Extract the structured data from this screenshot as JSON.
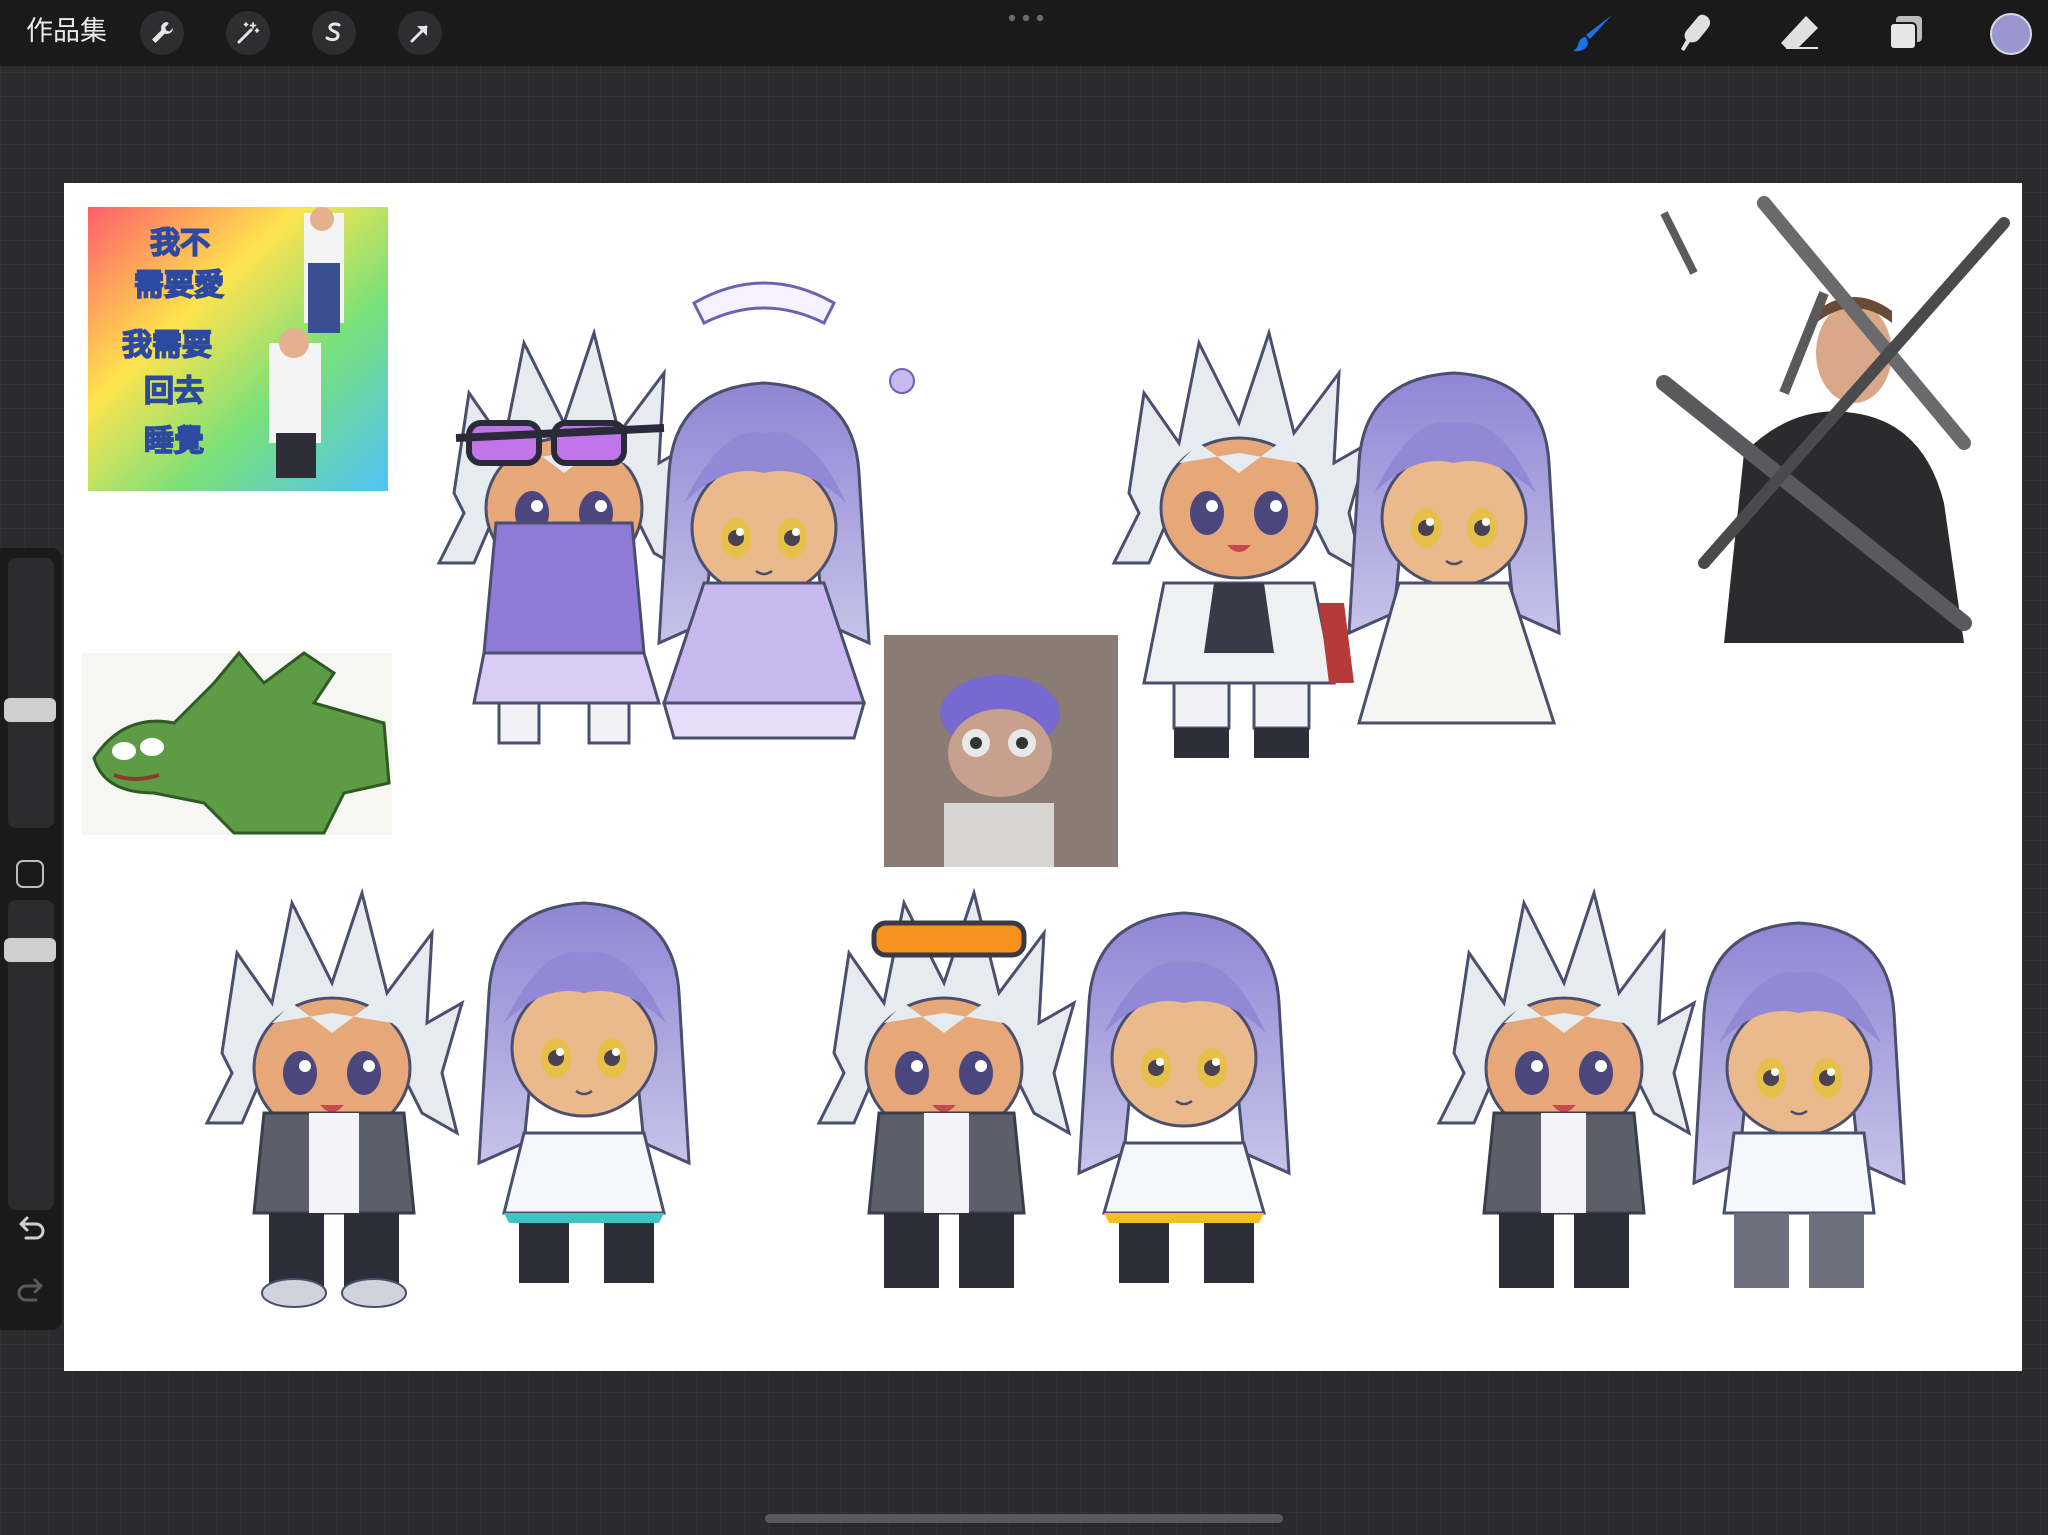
{
  "topbar": {
    "gallery_label": "作品集",
    "left_tools": [
      {
        "name": "actions",
        "icon": "wrench-icon"
      },
      {
        "name": "adjustments",
        "icon": "magic-wand-icon"
      },
      {
        "name": "selection",
        "icon": "selection-s-icon"
      },
      {
        "name": "transform",
        "icon": "arrow-cursor-icon"
      }
    ],
    "right_tools": [
      {
        "name": "brush",
        "icon": "brush-icon",
        "active": true
      },
      {
        "name": "smudge",
        "icon": "smudge-icon"
      },
      {
        "name": "eraser",
        "icon": "eraser-icon"
      },
      {
        "name": "layers",
        "icon": "layers-icon"
      }
    ],
    "active_color": "#9a97cf",
    "accent_color": "#1a73e8"
  },
  "canvas": {
    "meme_text": [
      "我不",
      "需要愛",
      "我需要",
      "回去",
      "睡覺"
    ],
    "background": "#ffffff"
  },
  "sidebar": {
    "icons": [
      "undo-icon",
      "redo-icon",
      "modify-square-icon"
    ]
  }
}
